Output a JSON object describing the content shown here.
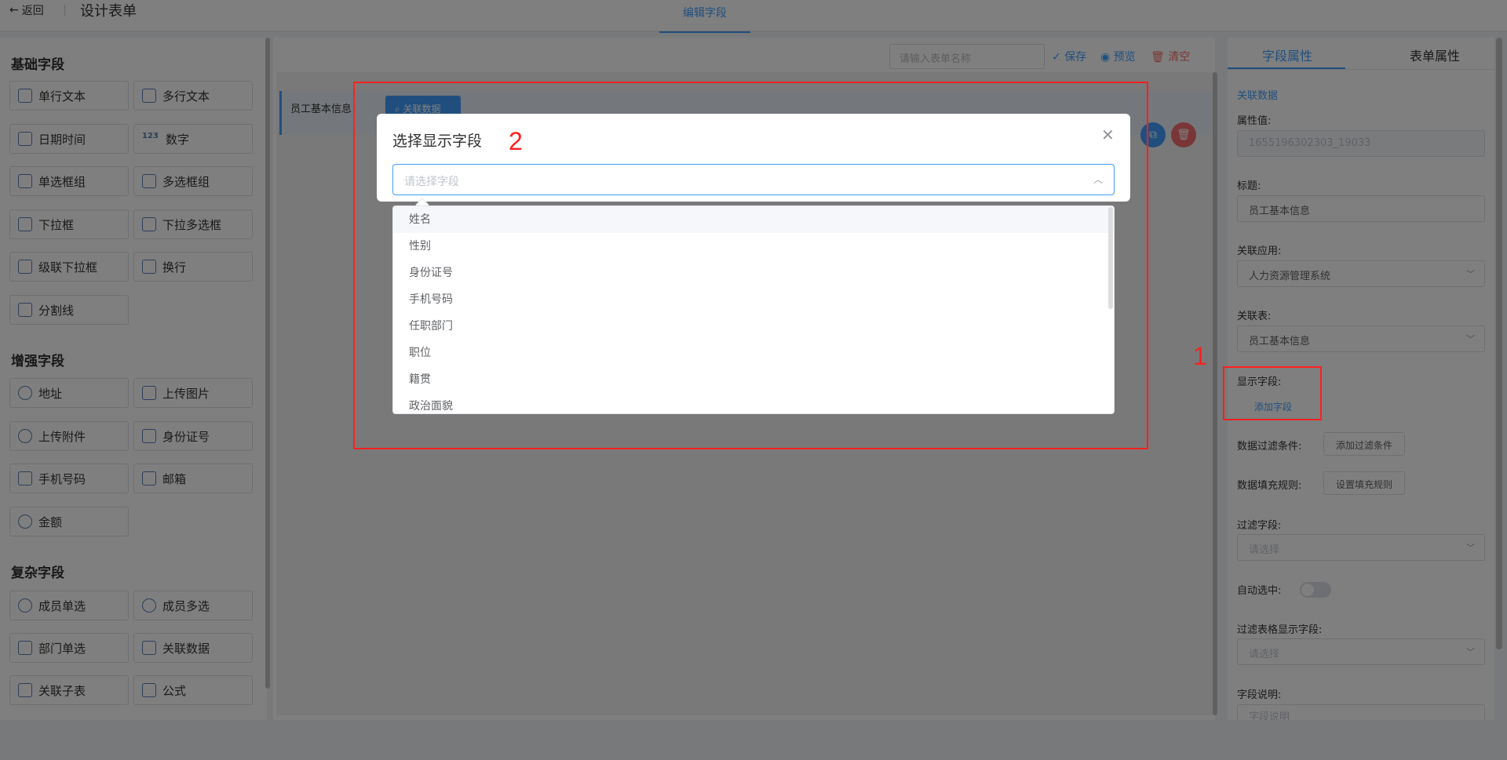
{
  "header": {
    "back_label": "返回",
    "title": "设计表单",
    "center_tab": "编辑字段"
  },
  "left": {
    "groups": [
      {
        "title": "基础字段",
        "items": [
          "单行文本",
          "多行文本",
          "日期时间",
          "数字",
          "单选框组",
          "多选框组",
          "下拉框",
          "下拉多选框",
          "级联下拉框",
          "换行",
          "分割线"
        ]
      },
      {
        "title": "增强字段",
        "items": [
          "地址",
          "上传图片",
          "上传附件",
          "身份证号",
          "手机号码",
          "邮箱",
          "金额"
        ]
      },
      {
        "title": "复杂字段",
        "items": [
          "成员单选",
          "成员多选",
          "部门单选",
          "关联数据",
          "关联子表",
          "公式"
        ]
      }
    ]
  },
  "canvas": {
    "form_name_placeholder": "请输入表单名称",
    "save": "保存",
    "preview": "预览",
    "clear": "清空",
    "field_label": "员工基本信息：",
    "related_button": "关联数据"
  },
  "right": {
    "tabs": [
      "字段属性",
      "表单属性"
    ],
    "type_title": "关联数据",
    "attr_value_label": "属性值:",
    "attr_value": "1655196302303_19033",
    "title_label": "标题:",
    "title_value": "员工基本信息",
    "app_label": "关联应用:",
    "app_value": "人力资源管理系统",
    "table_label": "关联表:",
    "table_value": "员工基本信息",
    "display_label": "显示字段:",
    "add_field": "添加字段",
    "filter_label": "数据过滤条件:",
    "filter_btn": "添加过滤条件",
    "fill_label": "数据填充规则:",
    "fill_btn": "设置填充规则",
    "filter_field_label": "过滤字段:",
    "filter_field_placeholder": "请选择",
    "auto_select_label": "自动选中:",
    "table_display_label": "过滤表格显示字段:",
    "table_display_placeholder": "请选择",
    "desc_label": "字段说明:",
    "desc_placeholder": "字段说明"
  },
  "annotations": {
    "one": "1",
    "two": "2"
  },
  "modal": {
    "title": "选择显示字段",
    "select_placeholder": "请选择字段",
    "options": [
      "姓名",
      "性别",
      "身份证号",
      "手机号码",
      "任职部门",
      "职位",
      "籍贯",
      "政治面貌"
    ]
  },
  "colors": {
    "primary": "#409eff",
    "danger": "#f56c6c",
    "annotation_red": "#ff2020"
  }
}
